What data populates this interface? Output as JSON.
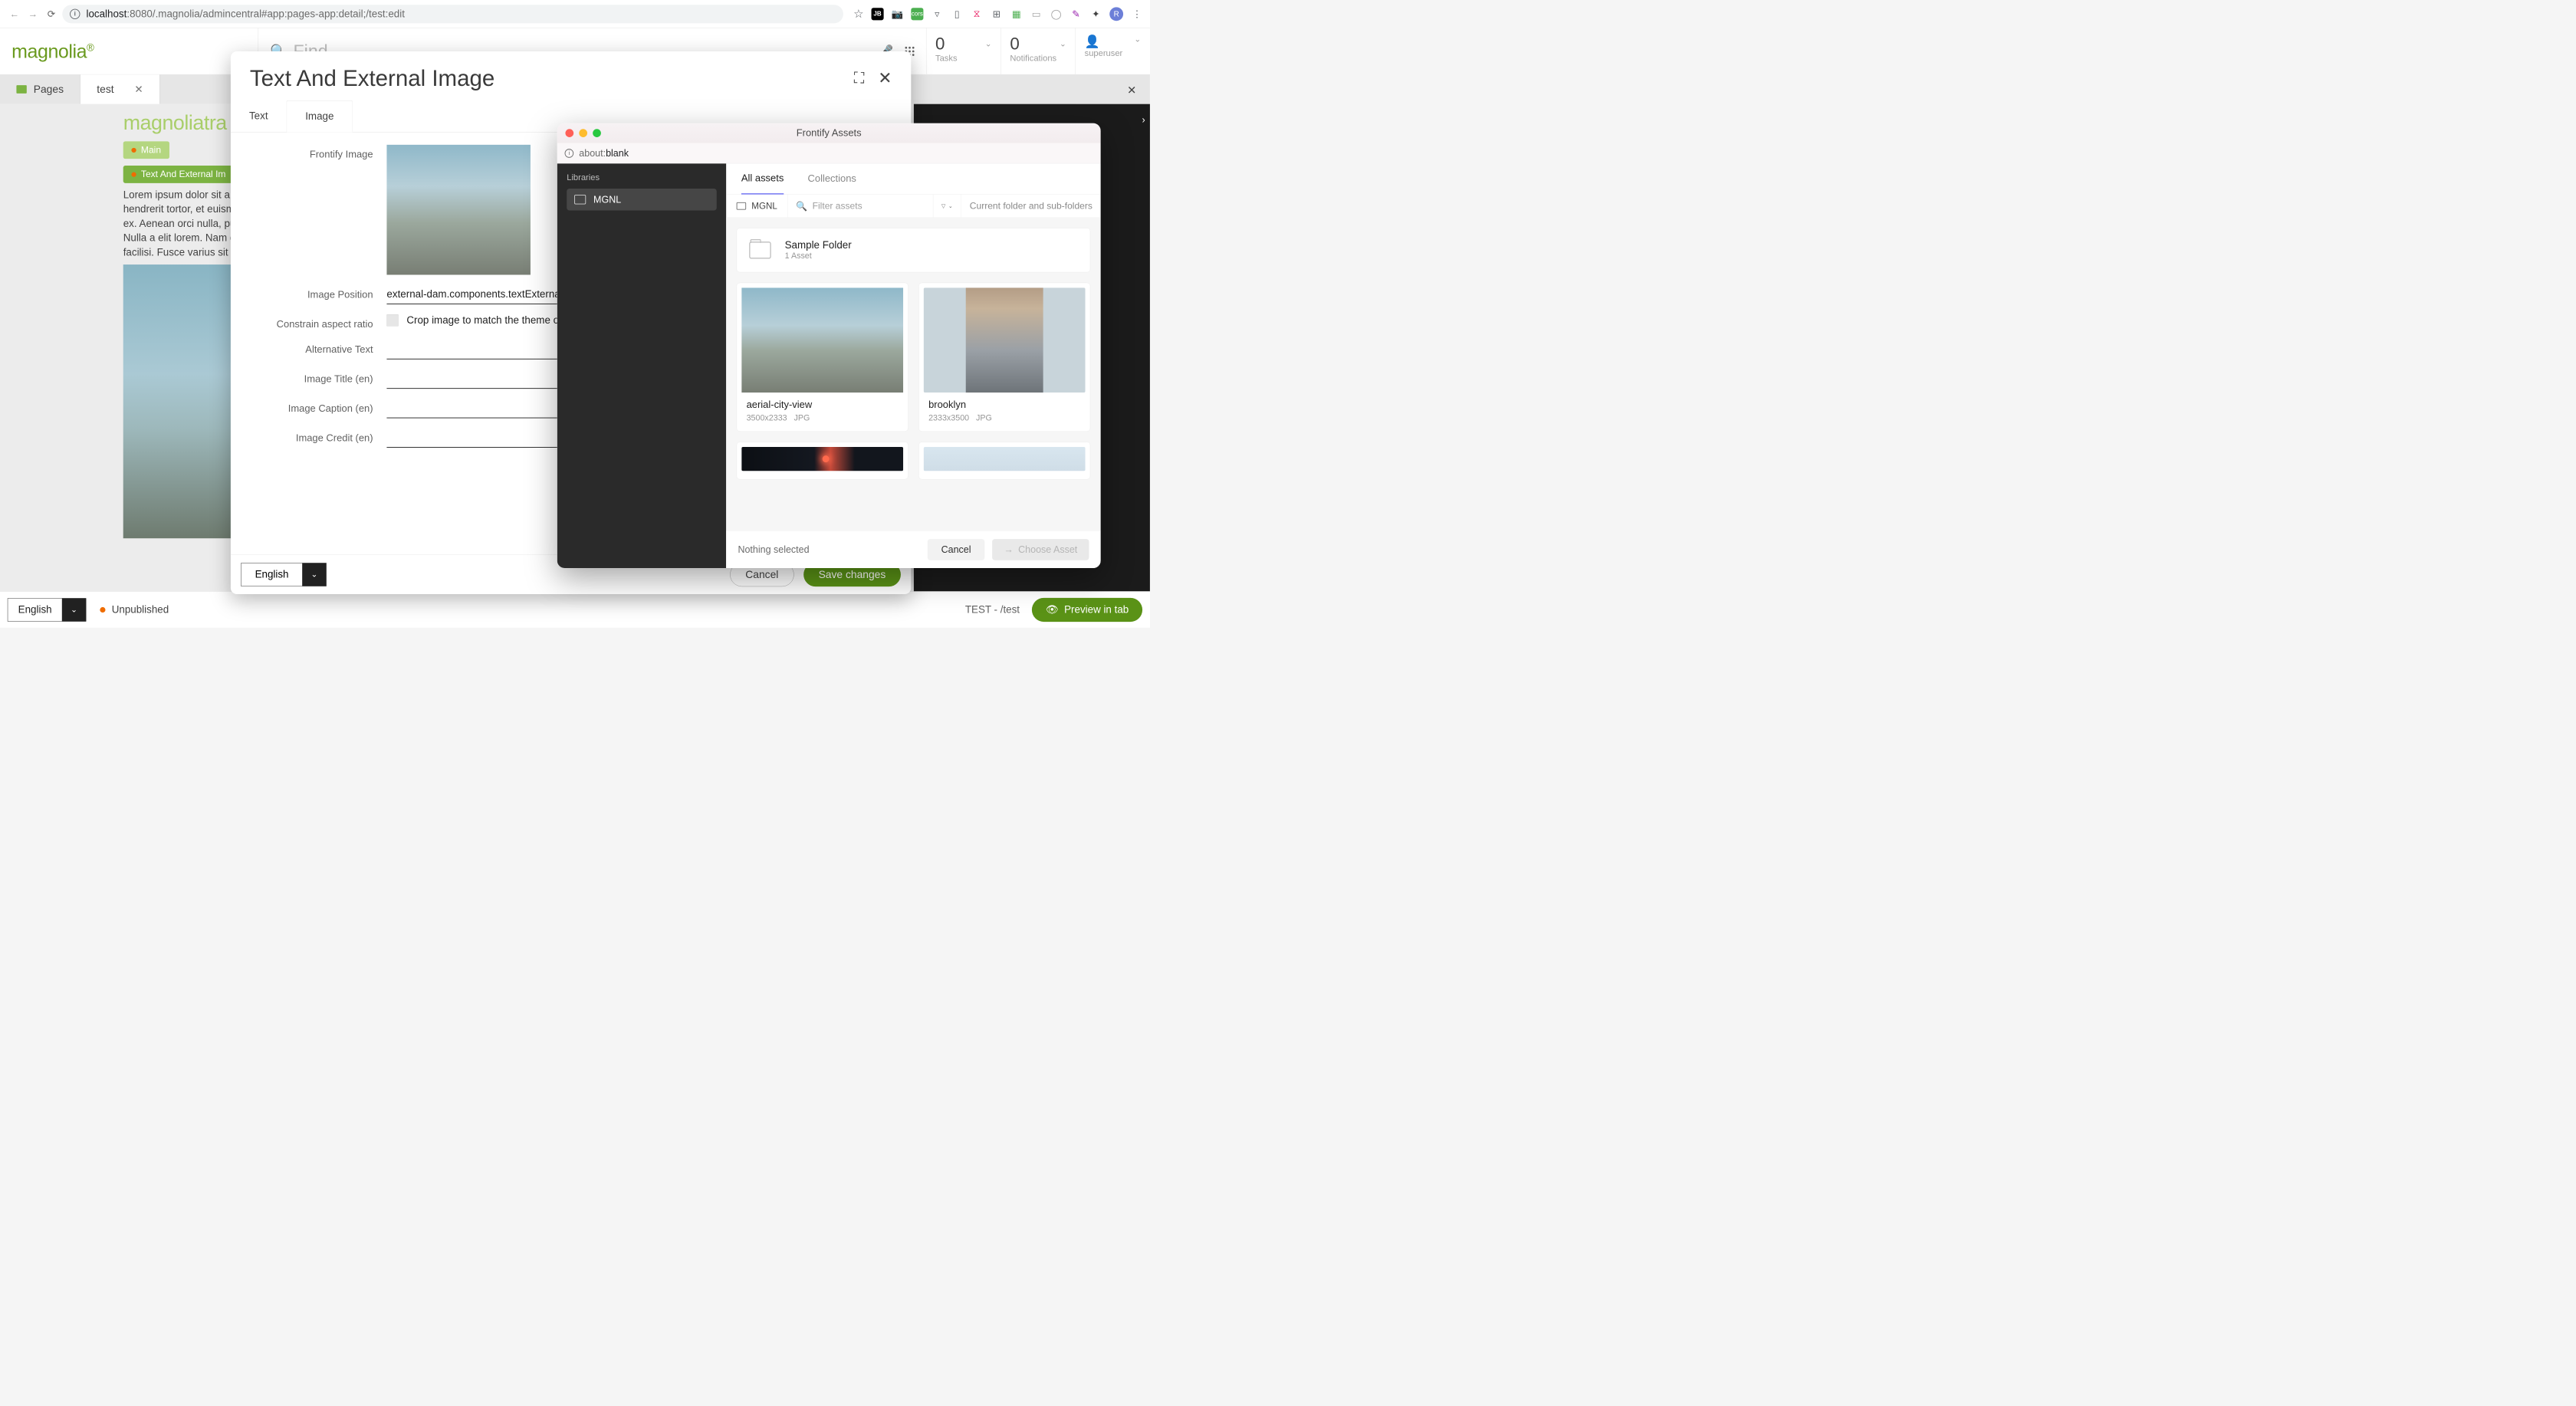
{
  "browser": {
    "host": "localhost",
    "port_path": ":8080/.magnolia/admincentral#app:pages-app:detail;/test:edit",
    "avatar_initial": "R"
  },
  "header": {
    "brand": "magnolia",
    "find_placeholder": "Find...",
    "tasks": {
      "count": "0",
      "label": "Tasks"
    },
    "notifications": {
      "count": "0",
      "label": "Notifications"
    },
    "user": {
      "label": "superuser"
    }
  },
  "tabs": {
    "pages": "Pages",
    "current": "test"
  },
  "preview": {
    "travel_brand": "magnoliatra",
    "chip_main": "Main",
    "chip_tei": "Text And External Im",
    "lorem": "Lorem ipsum dolor sit a\nhendrerit tortor, et euism\nex. Aenean orci nulla, pu\nNulla a elit lorem. Nam o\nfacilisi. Fusce varius sit"
  },
  "bottom": {
    "language": "English",
    "status": "Unpublished",
    "path": "TEST - /test",
    "preview_btn": "Preview in tab"
  },
  "dialog": {
    "title": "Text And External Image",
    "tabs": {
      "text": "Text",
      "image": "Image"
    },
    "fields": {
      "frontify_image": "Frontify Image",
      "image_position": "Image Position",
      "image_position_value": "external-dam.components.textExternal",
      "constrain": "Constrain aspect ratio",
      "constrain_text": "Crop image to match the theme of t",
      "alt_text": "Alternative Text",
      "title": "Image Title (en)",
      "caption": "Image Caption (en)",
      "credit": "Image Credit (en)"
    },
    "language": "English",
    "cancel": "Cancel",
    "save": "Save changes"
  },
  "frontify": {
    "window_title": "Frontify Assets",
    "url_prefix": "about:",
    "url_bold": "blank",
    "sidebar_heading": "Libraries",
    "library": "MGNL",
    "tabs": {
      "all": "All assets",
      "collections": "Collections"
    },
    "breadcrumb": "MGNL",
    "filter_placeholder": "Filter assets",
    "scope": "Current folder and sub-folders",
    "folder": {
      "name": "Sample Folder",
      "meta": "1 Asset"
    },
    "assets": [
      {
        "name": "aerial-city-view",
        "dims": "3500x2333",
        "fmt": "JPG"
      },
      {
        "name": "brooklyn",
        "dims": "2333x3500",
        "fmt": "JPG"
      }
    ],
    "selection": "Nothing selected",
    "cancel": "Cancel",
    "choose": "Choose Asset"
  }
}
